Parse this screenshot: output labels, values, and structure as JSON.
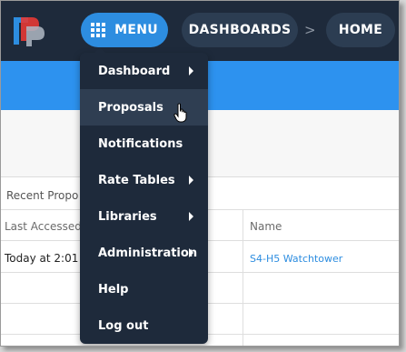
{
  "header": {
    "menu_label": "MENU",
    "dashboards_label": "DASHBOARDS",
    "separator": ">",
    "home_label": "HOME"
  },
  "menu": {
    "items": [
      {
        "label": "Dashboard",
        "has_submenu": true
      },
      {
        "label": "Proposals",
        "has_submenu": false,
        "hovered": true
      },
      {
        "label": "Notifications",
        "has_submenu": false
      },
      {
        "label": "Rate Tables",
        "has_submenu": true
      },
      {
        "label": "Libraries",
        "has_submenu": true
      },
      {
        "label": "Administration",
        "has_submenu": true
      },
      {
        "label": "Help",
        "has_submenu": false
      },
      {
        "label": "Log out",
        "has_submenu": false
      }
    ]
  },
  "recent": {
    "title": "Recent Propo",
    "columns": [
      "Last Accessed",
      "Name"
    ],
    "rows": [
      {
        "last_accessed": "Today at 2:01",
        "name": "S4-H5 Watchtower"
      }
    ]
  },
  "colors": {
    "topbar": "#1e2a3b",
    "accent": "#2d8de0",
    "bluebar": "#2d92ef",
    "menu_bg": "#1e2a3b"
  }
}
